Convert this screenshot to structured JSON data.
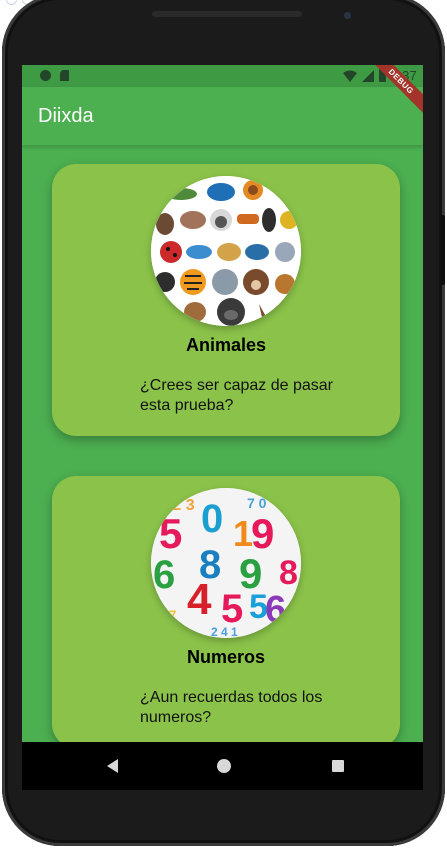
{
  "status_bar": {
    "time": "1:37",
    "icons": [
      "notification-dot-icon",
      "sd-card-icon",
      "wifi-icon",
      "signal-icon",
      "battery-icon"
    ]
  },
  "debug_banner": "DEBUG",
  "app_bar": {
    "title": "Diixda"
  },
  "cards": [
    {
      "title": "Animales",
      "description": "¿Crees ser capaz de pasar esta prueba?",
      "image": "animals-collage"
    },
    {
      "title": "Numeros",
      "description": "¿Aun recuerdas todos los numeros?",
      "image": "numbers-collage"
    }
  ],
  "nav_bar": {
    "icons": [
      "back-icon",
      "home-icon",
      "recents-icon"
    ]
  },
  "colors": {
    "app_bar": "#4caf50",
    "status_bar": "#3e9b43",
    "card": "#8bc34a",
    "background": "#4caf50"
  }
}
